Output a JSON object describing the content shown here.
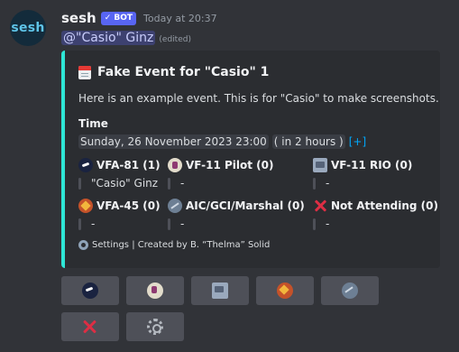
{
  "author": {
    "avatar_text": "sesh",
    "name": "sesh",
    "bot_tag": "✓ BOT",
    "timestamp": "Today at 20:37"
  },
  "message": {
    "mention": "@\"Casio\" Ginz",
    "edited": "(edited)"
  },
  "embed": {
    "accent_color": "#2ee6d6",
    "title_icon": "calendar-icon",
    "title": "Fake Event for \"Casio\" 1",
    "description": "Here is an example event. This is for \"Casio\" to make screenshots.",
    "time_label": "Time",
    "time_value": "Sunday, 26 November 2023 23:00",
    "time_relative": "( in 2 hours )",
    "time_link": "[+]",
    "fields": [
      {
        "icon": "jet-icon",
        "name": "VFA-81 (1)",
        "value": "\"Casio\" Ginz"
      },
      {
        "icon": "pilot-icon",
        "name": "VF-11 Pilot (0)",
        "value": "-"
      },
      {
        "icon": "rio-icon",
        "name": "VF-11 RIO (0)",
        "value": "-"
      },
      {
        "icon": "squadron-45-icon",
        "name": "VFA-45 (0)",
        "value": "-"
      },
      {
        "icon": "satellite-dish-icon",
        "name": "AIC/GCI/Marshal (0)",
        "value": "-"
      },
      {
        "icon": "cross-mark-icon",
        "name": "Not Attending (0)",
        "value": "-"
      }
    ],
    "footer": "Settings | Created by B. “Thelma” Solid"
  },
  "buttons": [
    {
      "icon": "jet-icon"
    },
    {
      "icon": "pilot-icon"
    },
    {
      "icon": "rio-icon"
    },
    {
      "icon": "squadron-45-icon"
    },
    {
      "icon": "satellite-dish-icon"
    },
    {
      "icon": "cross-mark-icon"
    },
    {
      "icon": "gear-icon"
    }
  ]
}
